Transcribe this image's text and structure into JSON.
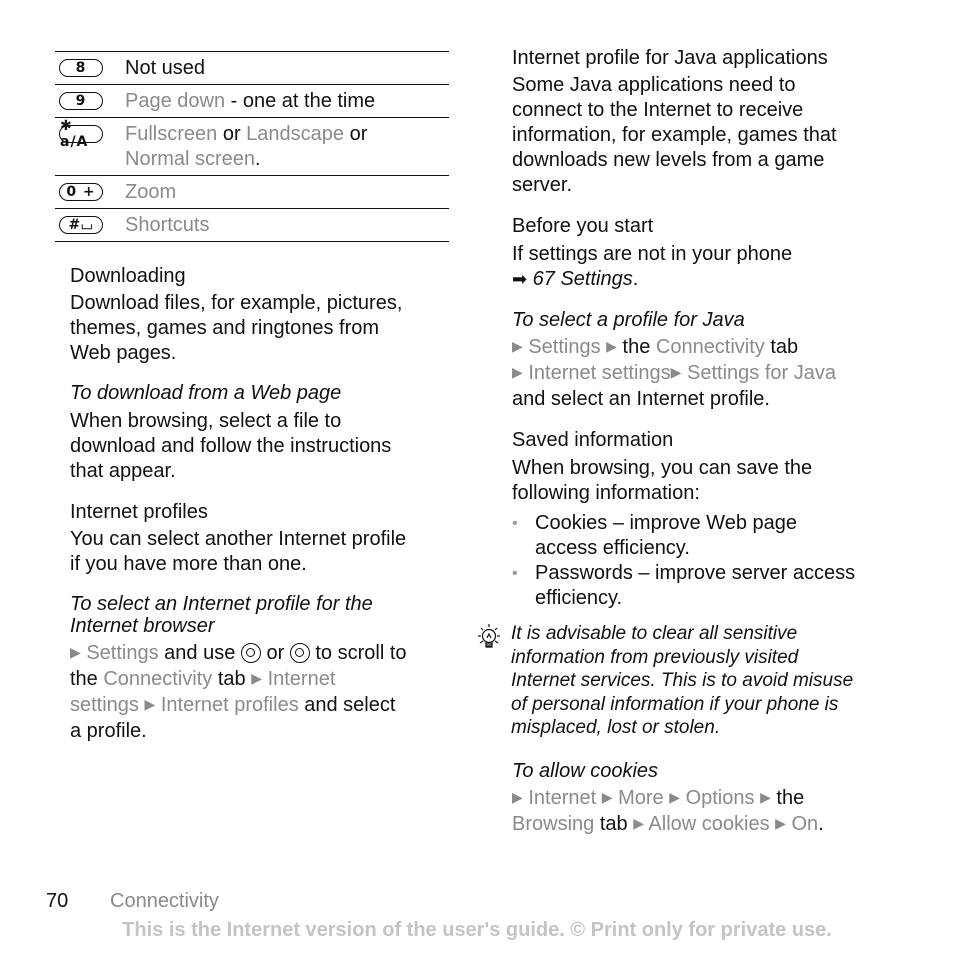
{
  "key_table": [
    {
      "key": "8",
      "icon": "key-8-icon",
      "parts": [
        {
          "t": "Not used",
          "g": false
        }
      ]
    },
    {
      "key": "9",
      "icon": "key-9-icon",
      "parts": [
        {
          "t": "Page down",
          "g": true
        },
        {
          "t": " - one at the time",
          "g": false
        }
      ]
    },
    {
      "key": "✱ a/A",
      "icon": "key-star-icon",
      "parts": [
        {
          "t": "Fullscreen",
          "g": true
        },
        {
          "t": " or ",
          "g": false
        },
        {
          "t": "Landscape",
          "g": true
        },
        {
          "t": " or ",
          "g": false
        },
        {
          "t": "Normal screen",
          "g": true
        },
        {
          "t": ".",
          "g": false
        }
      ]
    },
    {
      "key": "0 +",
      "icon": "key-0-icon",
      "parts": [
        {
          "t": "Zoom",
          "g": true
        }
      ]
    },
    {
      "key": "#⌴",
      "icon": "key-hash-icon",
      "parts": [
        {
          "t": "Shortcuts",
          "g": true
        }
      ]
    }
  ],
  "left": {
    "downloading_heading": "Downloading",
    "downloading_text": [
      "Download files, for example, pictures,",
      "themes, games and ringtones from",
      "Web pages."
    ],
    "download_task_heading": "To download from a Web page",
    "download_task_text": [
      "When browsing, select a file to",
      "download and follow the instructions",
      "that appear."
    ],
    "profiles_heading": "Internet profiles",
    "profiles_text": [
      "You can select another Internet profile",
      "if you have more than one."
    ],
    "select_task_heading": [
      "To select an Internet profile for the",
      "Internet browser"
    ],
    "select_steps": {
      "settings": "Settings",
      "and_use": " and use ",
      "or": " or ",
      "to_scroll": " to scroll to",
      "the": "the ",
      "connectivity": "Connectivity",
      "tab": " tab ",
      "internet": "Internet",
      "settings2": "settings",
      "internet_profiles": "Internet profiles",
      "and_select": " and select",
      "a_profile": "a profile."
    }
  },
  "right": {
    "java_heading": "Internet profile for Java applications",
    "java_text": [
      "Some Java applications need to",
      "connect to the Internet to receive",
      "information, for example, games that",
      "downloads new levels from a game",
      "server."
    ],
    "before_heading": "Before you start",
    "before_text": "If settings are not in your phone",
    "before_ref": "67 Settings",
    "java_task_heading": "To select a profile for Java",
    "java_steps": {
      "settings": "Settings",
      "the": " the ",
      "connectivity": "Connectivity",
      "tab": " tab",
      "internet_settings": "Internet settings",
      "settings_for_java": "Settings for Java",
      "and_select": "and select an Internet profile."
    },
    "saved_heading": "Saved information",
    "saved_text": [
      "When browsing, you can save the",
      "following information:"
    ],
    "bullets": [
      [
        "Cookies – improve Web page",
        "access efficiency."
      ],
      [
        "Passwords – improve server access",
        "efficiency."
      ]
    ],
    "tip": [
      "It is advisable to clear all sensitive",
      "information from previously visited",
      "Internet services. This is to avoid misuse",
      "of personal information if your phone is",
      "misplaced, lost or stolen."
    ],
    "cookies_heading": "To allow cookies",
    "cookies_steps": {
      "internet": "Internet",
      "more": "More",
      "options": "Options",
      "the": " the",
      "browsing": "Browsing",
      "tab": " tab ",
      "allow_cookies": "Allow cookies",
      "on": "On",
      "period": "."
    }
  },
  "footer": {
    "page_number": "70",
    "section": "Connectivity",
    "note": "This is the Internet version of the user's guide. © Print only for private use."
  }
}
